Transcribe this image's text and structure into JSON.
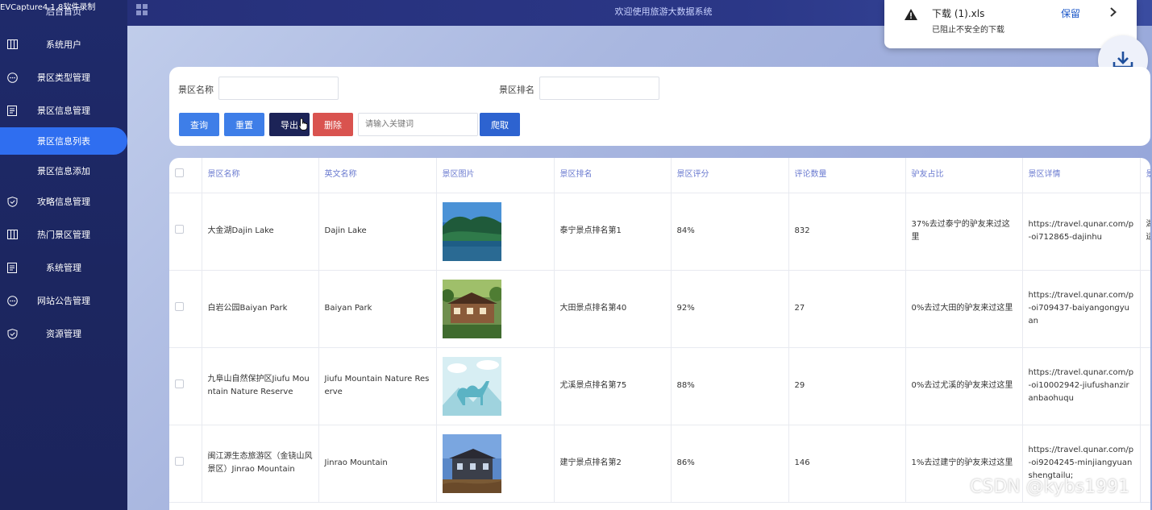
{
  "recorder_watermark": "EVCapture4.1.8软件录制",
  "sidebar": {
    "home": "后台首页",
    "items": [
      {
        "label": "系统用户",
        "icon": "columns-icon"
      },
      {
        "label": "景区类型管理",
        "icon": "chat-icon"
      },
      {
        "label": "景区信息管理",
        "icon": "document-icon"
      },
      {
        "label": "景区信息列表",
        "sub": true,
        "active": true
      },
      {
        "label": "景区信息添加",
        "sub": true
      },
      {
        "label": "攻略信息管理",
        "icon": "shield-icon"
      },
      {
        "label": "热门景区管理",
        "icon": "columns-icon"
      },
      {
        "label": "系统管理",
        "icon": "document-icon"
      },
      {
        "label": "网站公告管理",
        "icon": "chat-icon"
      },
      {
        "label": "资源管理",
        "icon": "shield-icon"
      }
    ]
  },
  "header": {
    "title": "欢迎使用旅游大数据系统"
  },
  "download": {
    "file": "下载 (1).xls",
    "message": "已阻止不安全的下载",
    "keep": "保留"
  },
  "search": {
    "name_label": "景区名称",
    "name_value": "",
    "rank_label": "景区排名",
    "rank_value": "",
    "query_btn": "查询",
    "reset_btn": "重置",
    "export_btn": "导出",
    "delete_btn": "删除",
    "keyword_placeholder": "请输入关键词",
    "crawl_btn": "爬取"
  },
  "table": {
    "headers": [
      "景区名称",
      "英文名称",
      "景区图片",
      "景区排名",
      "景区评分",
      "评论数量",
      "驴友占比",
      "景区详情",
      "景"
    ],
    "rows": [
      {
        "name": "大金湖Dajin Lake",
        "en": "Dajin Lake",
        "image": "lake-photo",
        "rank": "泰宁景点排名第1",
        "score": "84%",
        "comments": "832",
        "ratio": "37%去过泰宁的驴友来过这里",
        "detail": "https://travel.qunar.com/p-oi712865-dajinhu",
        "extra": "湖会适"
      },
      {
        "name": "白岩公园Baiyan Park",
        "en": "Baiyan Park",
        "image": "park-photo",
        "rank": "大田景点排名第40",
        "score": "92%",
        "comments": "27",
        "ratio": "0%去过大田的驴友来过这里",
        "detail": "https://travel.qunar.com/p-oi709437-baiyangongyuan",
        "extra": ""
      },
      {
        "name": "九阜山自然保护区Jiufu Mountain Nature Reserve",
        "en": "Jiufu Mountain Nature Reserve",
        "image": "camel-placeholder",
        "rank": "尤溪景点排名第75",
        "score": "88%",
        "comments": "29",
        "ratio": "0%去过尤溪的驴友来过这里",
        "detail": "https://travel.qunar.com/p-oi10002942-jiufushanziranbaohuqu",
        "extra": ""
      },
      {
        "name": "闽江源生态旅游区（金铙山风景区）Jinrao Mountain",
        "en": "Jinrao Mountain",
        "image": "house-photo",
        "rank": "建宁景点排名第2",
        "score": "86%",
        "comments": "146",
        "ratio": "1%去过建宁的驴友来过这里",
        "detail": "https://travel.qunar.com/p-oi9204245-minjiangyuanshengtailu;",
        "extra": ""
      }
    ]
  },
  "csdn_watermark": "CSDN @kybs1991",
  "colors": {
    "sidebar_bg": "#1f2a6b",
    "active_item": "#2f6ef0",
    "btn_blue": "#3e7ee8",
    "btn_navy": "#1c2357",
    "btn_red": "#d9534f",
    "header_text": "#6b7bd0"
  }
}
